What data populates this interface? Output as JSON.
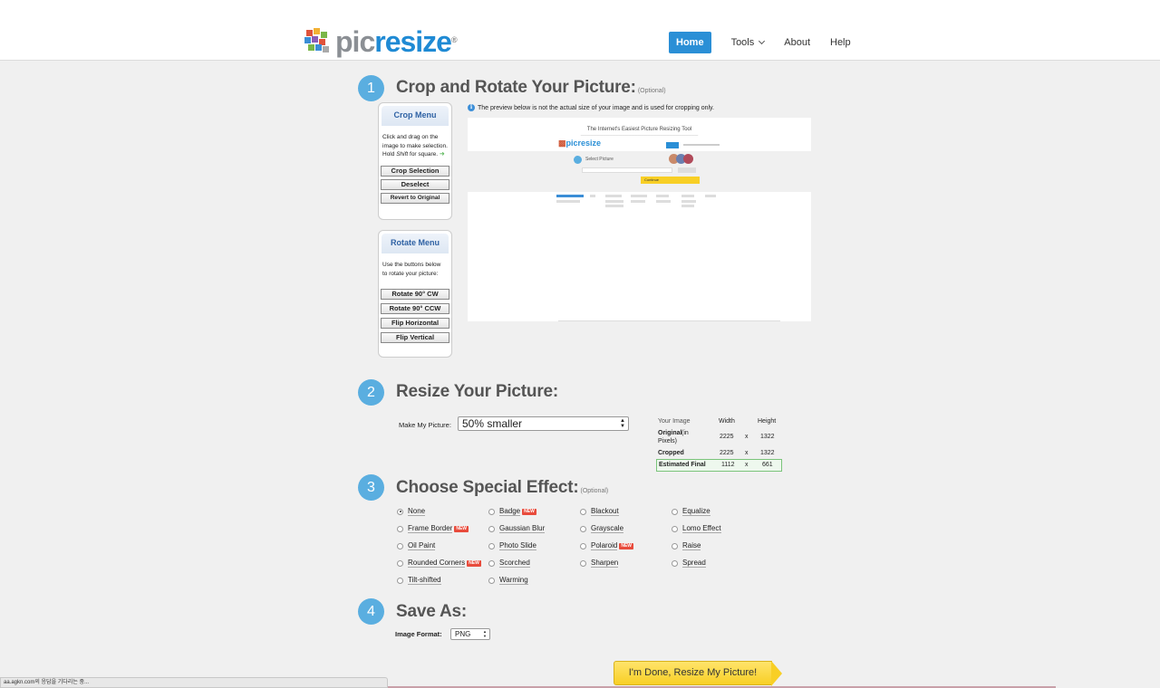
{
  "header": {
    "logo": {
      "pic": "pic",
      "resize": "resize",
      "reg": "®"
    },
    "nav": {
      "home": "Home",
      "tools": "Tools",
      "about": "About",
      "help": "Help"
    }
  },
  "step1": {
    "number": "1",
    "title": "Crop and Rotate Your Picture:",
    "optional": "(Optional)",
    "info": "The preview below is not the actual size of your image and is used for cropping only.",
    "crop_menu": {
      "title": "Crop Menu",
      "desc_line1": "Click and drag on the",
      "desc_line2": "image to make selection.",
      "desc_line3_pre": "Hold ",
      "desc_line3_em": "Shift",
      "desc_line3_post": " for square.",
      "buttons": [
        "Crop Selection",
        "Deselect",
        "Revert to Original"
      ]
    },
    "rotate_menu": {
      "title": "Rotate Menu",
      "desc_line1": "Use the buttons below",
      "desc_line2": "to rotate your picture:",
      "buttons": [
        "Rotate 90° CW",
        "Rotate 90° CCW",
        "Flip Horizontal",
        "Flip Vertical"
      ]
    },
    "preview": {
      "title": "The Internet's Easiest Picture Resizing Tool",
      "logo": "picresize",
      "select": "Select Picture",
      "continue": "Continue"
    }
  },
  "step2": {
    "number": "2",
    "title": "Resize Your Picture:",
    "make_label": "Make My Picture:",
    "make_value": "50% smaller",
    "table": {
      "h_image": "Your Image",
      "h_width": "Width",
      "h_height": "Height",
      "original": "Original",
      "original_suffix": "(in",
      "original_suffix2": "Pixels)",
      "cropped": "Cropped",
      "estimated": "Estimated Final",
      "x": "x",
      "orig_w": "2225",
      "orig_h": "1322",
      "crop_w": "2225",
      "crop_h": "1322",
      "est_w": "1112",
      "est_h": "661"
    }
  },
  "step3": {
    "number": "3",
    "title": "Choose Special Effect:",
    "optional": "(Optional)",
    "new_label": "NEW",
    "effects": [
      {
        "label": "None"
      },
      {
        "label": "Badge"
      },
      {
        "label": "Blackout"
      },
      {
        "label": "Equalize"
      },
      {
        "label": "Frame Border"
      },
      {
        "label": "Gaussian Blur"
      },
      {
        "label": "Grayscale"
      },
      {
        "label": "Lomo Effect"
      },
      {
        "label": "Oil Paint"
      },
      {
        "label": "Photo Slide"
      },
      {
        "label": "Polaroid"
      },
      {
        "label": "Raise"
      },
      {
        "label": "Rounded Corners"
      },
      {
        "label": "Scorched"
      },
      {
        "label": "Sharpen"
      },
      {
        "label": "Spread"
      },
      {
        "label": "Tilt-shifted"
      },
      {
        "label": "Warming"
      }
    ]
  },
  "step4": {
    "number": "4",
    "title": "Save As:",
    "format_label": "Image Format:",
    "format_value": "PNG",
    "done_button": "I'm Done, Resize My Picture!"
  },
  "status_bar": "aa.agkn.com의 응답을 기다리는 중...",
  "colors": {
    "accent": "#2a8fd6",
    "step_circle": "#5aaee0",
    "done_button": "#f8cf25",
    "new_badge": "#e84b3c"
  }
}
